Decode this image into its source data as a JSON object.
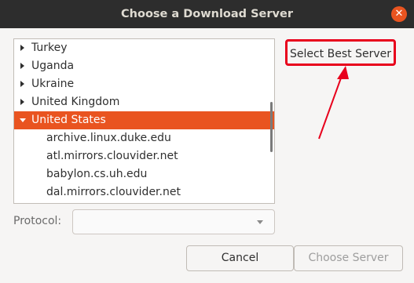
{
  "window": {
    "title": "Choose a Download Server",
    "close_glyph": "✕"
  },
  "tree": {
    "rows": [
      {
        "label": "Turkey",
        "expanded": false,
        "selected": false,
        "child": false
      },
      {
        "label": "Uganda",
        "expanded": false,
        "selected": false,
        "child": false
      },
      {
        "label": "Ukraine",
        "expanded": false,
        "selected": false,
        "child": false
      },
      {
        "label": "United Kingdom",
        "expanded": false,
        "selected": false,
        "child": false
      },
      {
        "label": "United States",
        "expanded": true,
        "selected": true,
        "child": false
      },
      {
        "label": "archive.linux.duke.edu",
        "child": true
      },
      {
        "label": "atl.mirrors.clouvider.net",
        "child": true
      },
      {
        "label": "babylon.cs.uh.edu",
        "child": true
      },
      {
        "label": "dal.mirrors.clouvider.net",
        "child": true
      }
    ]
  },
  "buttons": {
    "select_best": "Select Best Server",
    "cancel": "Cancel",
    "choose": "Choose Server"
  },
  "protocol": {
    "label": "Protocol:",
    "value": ""
  },
  "colors": {
    "titlebar": "#2d2d2d",
    "selection": "#e95420",
    "annotation": "#e8001c"
  }
}
